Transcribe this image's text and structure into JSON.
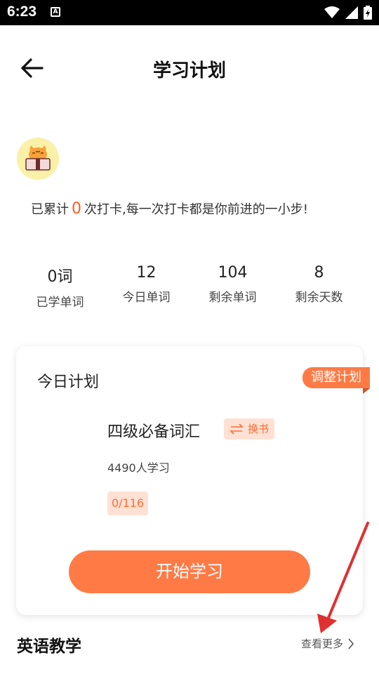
{
  "status_bar": {
    "time": "6:23",
    "notification_letter": "A",
    "icons": [
      "wifi-icon",
      "signal-icon",
      "battery-icon"
    ]
  },
  "header": {
    "title": "学习计划",
    "back_icon": "arrow-left-icon"
  },
  "checkin": {
    "prefix": "已累计",
    "count": "0",
    "suffix": "次打卡,每一次打卡都是你前进的一小步!"
  },
  "stats": [
    {
      "value": "0词",
      "label": "已学单词"
    },
    {
      "value": "12",
      "label": "今日单词"
    },
    {
      "value": "104",
      "label": "剩余单词"
    },
    {
      "value": "8",
      "label": "剩余天数"
    }
  ],
  "plan_card": {
    "title": "今日计划",
    "adjust_label": "调整计划",
    "book_name": "四级必备词汇",
    "swap_label": "换书",
    "learners": "4490人学习",
    "progress": "0/116",
    "start_label": "开始学习"
  },
  "section": {
    "title": "英语教学",
    "more_label": "查看更多"
  },
  "colors": {
    "accent": "#ff7a45",
    "accent_light": "#ffe1d4",
    "highlight_number": "#ff5a1f",
    "annotation_arrow": "#e03030"
  }
}
